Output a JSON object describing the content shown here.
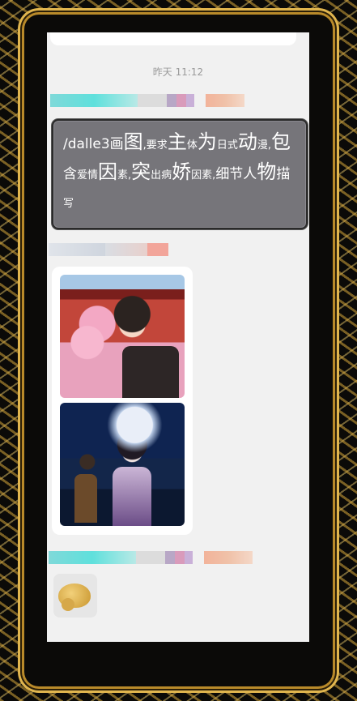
{
  "previous_message": "",
  "timestamp": "昨天 11:12",
  "message": {
    "segments": [
      {
        "text": "/dalle3画",
        "size": "m"
      },
      {
        "text": "图",
        "size": "l"
      },
      {
        "text": ",要求",
        "size": "s"
      },
      {
        "text": "主",
        "size": "l"
      },
      {
        "text": "体",
        "size": "s"
      },
      {
        "text": "为",
        "size": "l"
      },
      {
        "text": "日式",
        "size": "s"
      },
      {
        "text": "动",
        "size": "l"
      },
      {
        "text": "漫,",
        "size": "s"
      },
      {
        "text": "包",
        "size": "l"
      },
      {
        "text": "含",
        "size": "m"
      },
      {
        "text": "爱情",
        "size": "s"
      },
      {
        "text": "因",
        "size": "l"
      },
      {
        "text": "素,",
        "size": "s"
      },
      {
        "text": "突",
        "size": "l"
      },
      {
        "text": "出病",
        "size": "s"
      },
      {
        "text": "娇",
        "size": "l"
      },
      {
        "text": "因素,",
        "size": "s"
      },
      {
        "text": "细节人",
        "size": "m"
      },
      {
        "text": "物",
        "size": "l"
      },
      {
        "text": "描",
        "size": "m"
      },
      {
        "text": "写",
        "size": "s"
      }
    ]
  },
  "colors": {
    "bubble_bg": "#76757a",
    "screen_bg": "#f1f1f1",
    "frame_gold": "#e0b54e"
  },
  "images": [
    {
      "name": "generated-image-couple-hug"
    },
    {
      "name": "generated-image-moonlit-yandere"
    }
  ],
  "sticker": {
    "icon": "emoji-sticker-icon"
  }
}
